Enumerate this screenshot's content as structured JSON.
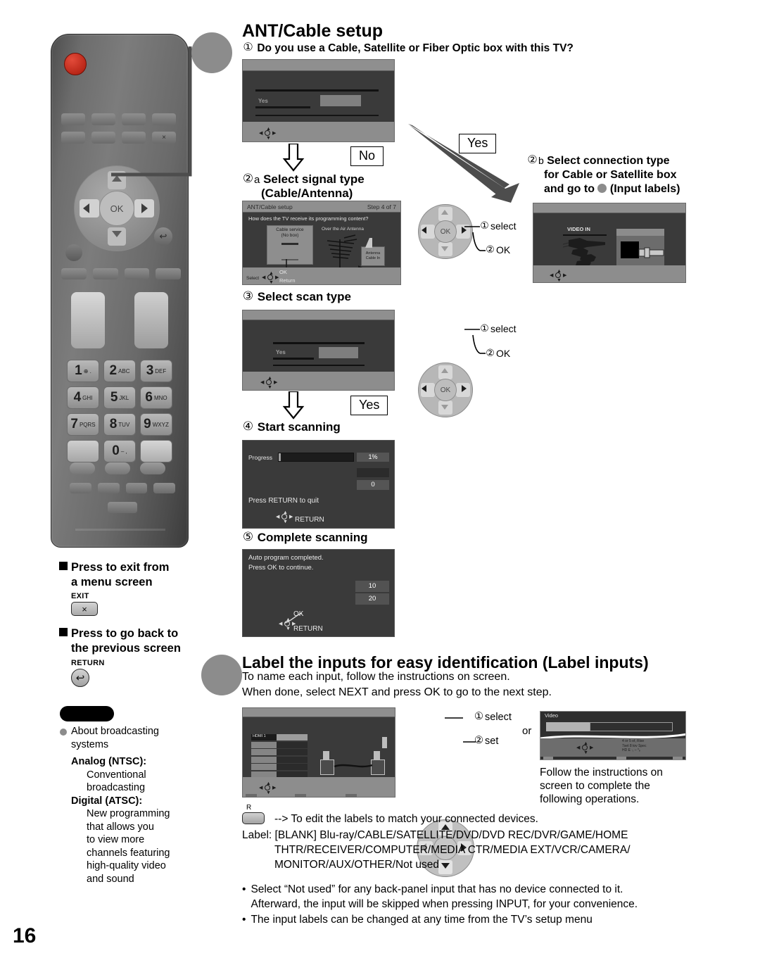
{
  "page": {
    "number": "16"
  },
  "section1": {
    "title": "ANT/Cable setup",
    "step1": {
      "num": "①",
      "text": "Do you use a Cable, Satellite or Fiber Optic box with this TV?"
    },
    "branch_no": "No",
    "branch_yes": "Yes",
    "step2a": {
      "num": "②",
      "letter": "a",
      "line1": "Select signal type",
      "line2": "(Cable/Antenna)"
    },
    "step2b": {
      "num": "②",
      "letter": "b",
      "line1": "Select connection type",
      "line2": "for Cable or Satellite box",
      "line3a": "and go to",
      "line3b": "(Input labels)"
    },
    "step3": {
      "num": "③",
      "text": "Select scan type"
    },
    "step3_branch": "Yes",
    "step4": {
      "num": "④",
      "text": "Start scanning"
    },
    "step5": {
      "num": "⑤",
      "text": "Complete scanning"
    },
    "ring1": {
      "sel_num": "①",
      "sel_label": "select",
      "ok_num": "②",
      "ok_label": "OK",
      "ok_glyph": "OK"
    },
    "ring2": {
      "sel_num": "①",
      "sel_label": "select",
      "ok_num": "②",
      "ok_label": "OK",
      "ok_glyph": "OK"
    }
  },
  "tv_screens": {
    "signal_type": {
      "title": "ANT/Cable setup",
      "step": "Step 4 of 7",
      "question": "How does the TV receive its programming content?",
      "opt_cable_l1": "Cable service",
      "opt_cable_l2": "(No box)",
      "opt_antenna": "Over the Air Antenna",
      "jack_l1": "Antenna",
      "jack_l2": "Cable In",
      "footer_select": "Select",
      "footer_ok": "OK",
      "footer_return": "Return"
    },
    "connection_type": {
      "video_in": "VIDEO IN"
    },
    "scan_type": {
      "yes_label": "Yes"
    },
    "first_screen": {
      "yes_label": "Yes"
    },
    "progress": {
      "label": "Progress",
      "percent": "1%",
      "count": "0",
      "quit_text": "Press RETURN to quit",
      "return_label": "RETURN"
    },
    "complete": {
      "line1": "Auto program completed.",
      "line2": "Press OK to continue.",
      "val1": "10",
      "val2": "20",
      "ok_label": "OK",
      "return_label": "RETURN"
    },
    "label_inputs": {
      "row1": "HDMI 1"
    },
    "video_small": {
      "title": "Video",
      "hint1": "4 or 5 of, Rise",
      "hint2": "7set 8 tov Spec",
      "hint3": "HD  E  ·, – °ₑ"
    }
  },
  "remote": {
    "exit": {
      "heading_l1": "Press to exit from",
      "heading_l2": "a menu screen",
      "key_label": "EXIT",
      "key_glyph": "×"
    },
    "return": {
      "heading_l1": "Press to go back to",
      "heading_l2": "the previous screen",
      "key_label": "RETURN",
      "key_glyph": "↩"
    },
    "ok_glyph": "OK",
    "keypad": [
      {
        "digit": "1",
        "sub": "⊕ ."
      },
      {
        "digit": "2",
        "sub": "ABC"
      },
      {
        "digit": "3",
        "sub": "DEF"
      },
      {
        "digit": "4",
        "sub": "GHI"
      },
      {
        "digit": "5",
        "sub": "JKL"
      },
      {
        "digit": "6",
        "sub": "MNO"
      },
      {
        "digit": "7",
        "sub": "PQRS"
      },
      {
        "digit": "8",
        "sub": "TUV"
      },
      {
        "digit": "9",
        "sub": "WXYZ"
      },
      {
        "digit": "0",
        "sub": "– ,"
      }
    ]
  },
  "note": {
    "bullet": "About broadcasting",
    "bullet_l2": "systems",
    "analog_label": "Analog (NTSC):",
    "analog_l1": "Conventional",
    "analog_l2": "broadcasting",
    "digital_label": "Digital (ATSC):",
    "digital_l1": "New programming",
    "digital_l2": "that allows you",
    "digital_l3": "to view more",
    "digital_l4": "channels featuring",
    "digital_l5": "high-quality video",
    "digital_l6": "and sound"
  },
  "section2": {
    "title": "Label the inputs for easy identification (Label inputs)",
    "intro_l1": "To name each input, follow the instructions on screen.",
    "intro_l2": "When done, select NEXT and press OK to go to the next step.",
    "ring": {
      "sel_num": "①",
      "sel_label": "select",
      "set_num": "②",
      "set_label": "set",
      "or": "or",
      "ok_glyph": "OK"
    },
    "follow_l1": "Follow the instructions on",
    "follow_l2": "screen to complete the",
    "follow_l3": "following operations.",
    "rkey_label": "R",
    "edit_note": "--> To edit the labels to match your connected devices.",
    "label_prefix": "Label:",
    "label_l1": "[BLANK] Blu-ray/CABLE/SATELLITE/DVD/DVD REC/DVR/GAME/HOME",
    "label_l2": "THTR/RECEIVER/COMPUTER/MEDIA CTR/MEDIA EXT/VCR/CAMERA/",
    "label_l3": "MONITOR/AUX/OTHER/Not used",
    "bullets": [
      {
        "l1": "Select “Not used” for any back-panel input that has no device connected to it.",
        "l2": "Afterward, the input will be skipped when pressing INPUT, for your convenience."
      },
      {
        "l1": "The input labels can be changed at any time from the TV’s setup menu",
        "l2": ""
      }
    ]
  }
}
